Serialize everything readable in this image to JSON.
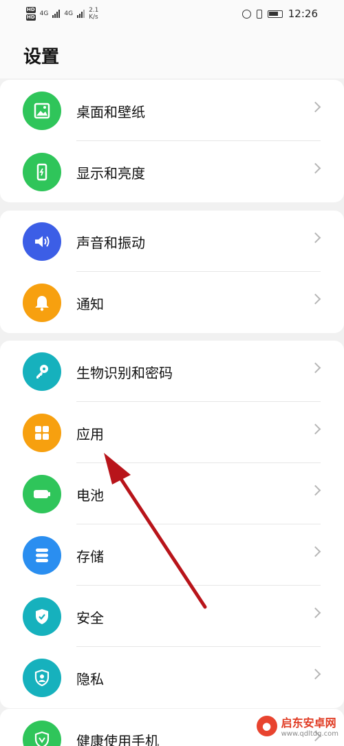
{
  "status_bar": {
    "speed_value": "2.1",
    "speed_unit": "K/s",
    "time": "12:26",
    "network_1": "4G",
    "network_2": "4G"
  },
  "header": {
    "title": "设置"
  },
  "groups": [
    {
      "items": [
        {
          "label": "桌面和壁纸",
          "icon": "wallpaper-icon",
          "color": "#2fc55a"
        },
        {
          "label": "显示和亮度",
          "icon": "display-icon",
          "color": "#2fc55a"
        }
      ]
    },
    {
      "items": [
        {
          "label": "声音和振动",
          "icon": "sound-icon",
          "color": "#3c5ee6"
        },
        {
          "label": "通知",
          "icon": "bell-icon",
          "color": "#f7a00f"
        }
      ]
    },
    {
      "items": [
        {
          "label": "生物识别和密码",
          "icon": "key-icon",
          "color": "#16b1bd"
        },
        {
          "label": "应用",
          "icon": "apps-icon",
          "color": "#f7a00f"
        },
        {
          "label": "电池",
          "icon": "battery-icon",
          "color": "#2fc55a"
        },
        {
          "label": "存储",
          "icon": "storage-icon",
          "color": "#2a8ef0"
        },
        {
          "label": "安全",
          "icon": "shield-check-icon",
          "color": "#16b1bd"
        },
        {
          "label": "隐私",
          "icon": "privacy-icon",
          "color": "#16b1bd"
        }
      ]
    },
    {
      "items": [
        {
          "label": "健康使用手机",
          "icon": "health-icon",
          "color": "#2fc55a"
        }
      ]
    }
  ],
  "watermark": {
    "title": "启东安卓网",
    "url": "www.qdltdq.com"
  },
  "colors": {
    "annotation_arrow": "#b8141a"
  }
}
